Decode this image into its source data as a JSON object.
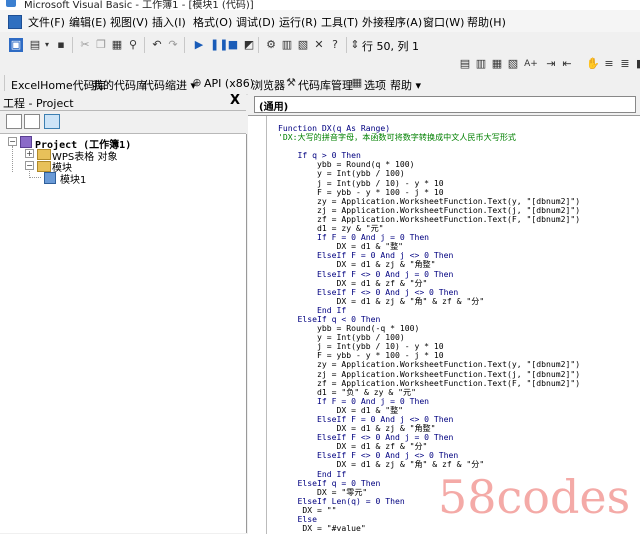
{
  "window": {
    "title": "Microsoft Visual Basic - 工作簿1 - [模块1 (代码)]"
  },
  "menu": [
    "文件(F)",
    "编辑(E)",
    "视图(V)",
    "插入(I)",
    "格式(O)",
    "调试(D)",
    "运行(R)",
    "工具(T)",
    "外接程序(A)",
    "窗口(W)",
    "帮助(H)"
  ],
  "toolbar": {
    "position": "行 50, 列 1"
  },
  "toolbar2": {
    "items": [
      "ExcelHome代码库",
      "我的代码库",
      "代码缩进 ▾",
      "API (x86)",
      "浏览器",
      "代码库管理",
      "选项",
      "帮助 ▾"
    ]
  },
  "project_panel": {
    "title": "工程 - Project",
    "close": "X",
    "tree": {
      "root": "Project (工作簿1)",
      "wps_folder": "WPS表格 对象",
      "modules_folder": "模块",
      "module1": "模块1"
    }
  },
  "code_window": {
    "object_combo": "(通用)",
    "lines": [
      {
        "t": "Function DX(q As Range)",
        "c": "kw"
      },
      {
        "t": "'DX:大写的拼音字母，本函数可将数字转换成中文人民币大写形式",
        "c": "cm"
      },
      {
        "t": "",
        "c": ""
      },
      {
        "t": "    If q > 0 Then",
        "c": "kw"
      },
      {
        "t": "        ybb = Round(q * 100)",
        "c": ""
      },
      {
        "t": "        y = Int(ybb / 100)",
        "c": ""
      },
      {
        "t": "        j = Int(ybb / 10) - y * 10",
        "c": ""
      },
      {
        "t": "        F = ybb - y * 100 - j * 10",
        "c": ""
      },
      {
        "t": "        zy = Application.WorksheetFunction.Text(y, \"[dbnum2]\")",
        "c": ""
      },
      {
        "t": "        zj = Application.WorksheetFunction.Text(j, \"[dbnum2]\")",
        "c": ""
      },
      {
        "t": "        zf = Application.WorksheetFunction.Text(F, \"[dbnum2]\")",
        "c": ""
      },
      {
        "t": "        d1 = zy & \"元\"",
        "c": ""
      },
      {
        "t": "        If F = 0 And j = 0 Then",
        "c": "kw"
      },
      {
        "t": "            DX = d1 & \"整\"",
        "c": ""
      },
      {
        "t": "        ElseIf F = 0 And j <> 0 Then",
        "c": "kw"
      },
      {
        "t": "            DX = d1 & zj & \"角整\"",
        "c": ""
      },
      {
        "t": "        ElseIf F <> 0 And j = 0 Then",
        "c": "kw"
      },
      {
        "t": "            DX = d1 & zf & \"分\"",
        "c": ""
      },
      {
        "t": "        ElseIf F <> 0 And j <> 0 Then",
        "c": "kw"
      },
      {
        "t": "            DX = d1 & zj & \"角\" & zf & \"分\"",
        "c": ""
      },
      {
        "t": "        End If",
        "c": "kw"
      },
      {
        "t": "    ElseIf q < 0 Then",
        "c": "kw"
      },
      {
        "t": "        ybb = Round(-q * 100)",
        "c": ""
      },
      {
        "t": "        y = Int(ybb / 100)",
        "c": ""
      },
      {
        "t": "        j = Int(ybb / 10) - y * 10",
        "c": ""
      },
      {
        "t": "        F = ybb - y * 100 - j * 10",
        "c": ""
      },
      {
        "t": "        zy = Application.WorksheetFunction.Text(y, \"[dbnum2]\")",
        "c": ""
      },
      {
        "t": "        zj = Application.WorksheetFunction.Text(j, \"[dbnum2]\")",
        "c": ""
      },
      {
        "t": "        zf = Application.WorksheetFunction.Text(F, \"[dbnum2]\")",
        "c": ""
      },
      {
        "t": "        d1 = \"负\" & zy & \"元\"",
        "c": ""
      },
      {
        "t": "        If F = 0 And j = 0 Then",
        "c": "kw"
      },
      {
        "t": "            DX = d1 & \"整\"",
        "c": ""
      },
      {
        "t": "        ElseIf F = 0 And j <> 0 Then",
        "c": "kw"
      },
      {
        "t": "            DX = d1 & zj & \"角整\"",
        "c": ""
      },
      {
        "t": "        ElseIf F <> 0 And j = 0 Then",
        "c": "kw"
      },
      {
        "t": "            DX = d1 & zf & \"分\"",
        "c": ""
      },
      {
        "t": "        ElseIf F <> 0 And j <> 0 Then",
        "c": "kw"
      },
      {
        "t": "            DX = d1 & zj & \"角\" & zf & \"分\"",
        "c": ""
      },
      {
        "t": "        End If",
        "c": "kw"
      },
      {
        "t": "    ElseIf q = 0 Then",
        "c": "kw"
      },
      {
        "t": "        DX = \"零元\"",
        "c": ""
      },
      {
        "t": "    ElseIf Len(q) = 0 Then",
        "c": "kw"
      },
      {
        "t": "     DX = \"\"",
        "c": ""
      },
      {
        "t": "    Else",
        "c": "kw"
      },
      {
        "t": "     DX = \"#value\"",
        "c": ""
      }
    ]
  },
  "watermark": "58codes"
}
